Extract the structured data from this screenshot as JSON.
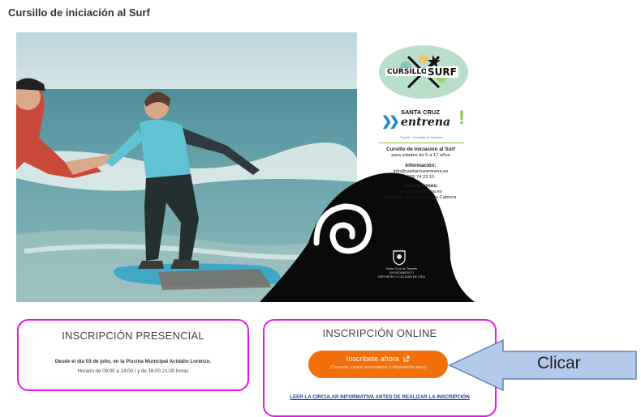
{
  "page": {
    "title": "Cursillo de iniciación al Surf"
  },
  "poster": {
    "logo_left": "CURSILLO",
    "logo_right": "SURF",
    "brand_top": "SANTA CRUZ",
    "brand_main": "entrena",
    "brand_tagline": "Tenerife · Concejalía de Deportes",
    "info_title": "Cursillo de iniciación al Surf",
    "info_ages": "para edades de 6 a 17 años",
    "info_heading": "Información:",
    "info_email": "info@santacruzentrena.es",
    "info_phone": "609 74 23 10",
    "inscr_heading": "Inscripciones:",
    "inscr_web": "santacruzentrena.es",
    "inscr_place": "Pabellón Municipal Quico Cabrera",
    "crest_text": "Santa Cruz de Tenerife\nAYUNTAMIENTO\nDEPORTES Y CALIDAD DE VIDA"
  },
  "presencial": {
    "title": "INSCRIPCIÓN PRESENCIAL",
    "line1": "Desde el día 03 de julio, en la Piscina Municipal Acidalio Lorenzo.",
    "line2": "Horario de 09:00 a 14:00 / y de 16:00 21:00 horas"
  },
  "online": {
    "title": "INSCRIPCIÓN ONLINE",
    "button_label": "Inscríbete ahora",
    "button_sub": "(Cerrado: cupos incompletos a disposición aquí)",
    "link_label": "LEER LA CIRCULAR INFORMATIVA ANTES DE REALIZAR LA INSCRIPCIÓN"
  },
  "callout": {
    "label": "Clicar"
  },
  "colors": {
    "accent_border": "#e21ae0",
    "button": "#f36f0a",
    "callout_fill": "#b3cbe8",
    "link": "#1e3f9a"
  }
}
